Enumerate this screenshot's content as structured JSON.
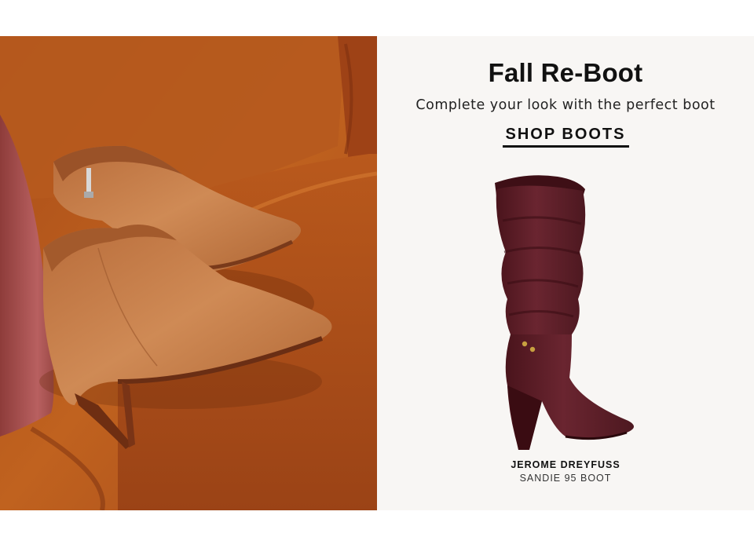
{
  "promo": {
    "headline": "Fall Re-Boot",
    "subhead": "Complete your look with the perfect boot",
    "cta_label": "SHOP BOOTS"
  },
  "product": {
    "brand": "JEROME DREYFUSS",
    "name": "SANDIE 95 BOOT"
  },
  "colors": {
    "photo_background": "#b8581f",
    "panel_background": "#f8f6f4",
    "ankle_boot": "#c8834f",
    "tall_boot": "#5c1c25",
    "text": "#111111"
  }
}
